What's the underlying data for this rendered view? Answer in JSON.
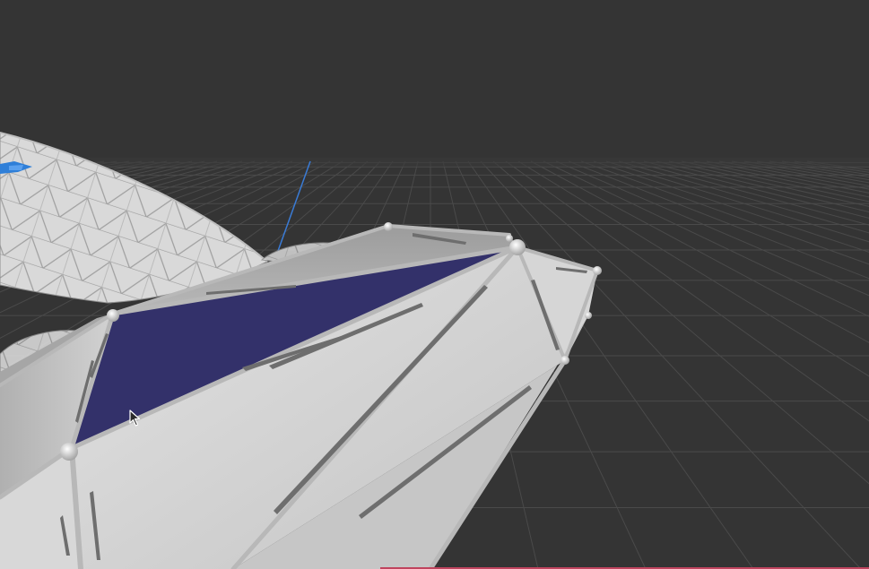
{
  "viewport": {
    "background_color": "#343434",
    "grid_color": "#4a4a4a",
    "mesh_base_color": "#cfcfcf",
    "mesh_shadow_color": "#9a9a9a",
    "mesh_edge_color": "#b5b5b5",
    "selected_face_color": "#33316a",
    "axis_z_color": "#3a7bd5",
    "gizmo_color": "#2f7fd8",
    "accent_line_color": "#c0445e"
  },
  "objects": {
    "background_mesh": "triangulated-surface",
    "foreground_mesh": "wireframe-skeleton-mesh",
    "selection": "selected-face"
  },
  "icons": {
    "cursor": "mouse-pointer-icon",
    "gizmo": "transform-gizmo-icon"
  }
}
